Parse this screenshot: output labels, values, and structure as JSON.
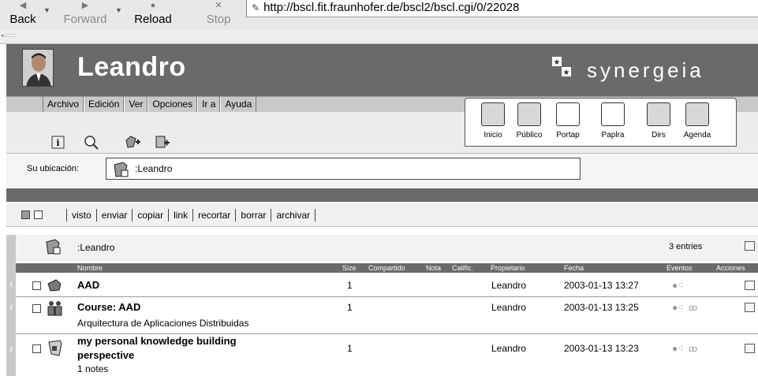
{
  "browser": {
    "back": "Back",
    "forward": "Forward",
    "reload": "Reload",
    "stop": "Stop",
    "url": "http://bscl.fit.fraunhofer.de/bscl2/bscl.cgi/0/22028"
  },
  "header": {
    "user_name": "Leandro",
    "brand": "synergeia"
  },
  "menu": [
    "Archivo",
    "Edición",
    "Ver",
    "Opciones",
    "Ir a",
    "Ayuda"
  ],
  "nav_tiles": [
    "Inicio",
    "Público",
    "Portap",
    "Paplra",
    "Dirs",
    "Agenda"
  ],
  "location": {
    "label": "Su ubicación:",
    "value": ":Leandro"
  },
  "actions": [
    "visto",
    "enviar",
    "copiar",
    "link",
    "recortar",
    "borrar",
    "archivar"
  ],
  "folder": {
    "name": ":Leandro",
    "entries": "3 entries"
  },
  "columns": {
    "nombre": "Nombre",
    "size": "Size",
    "compartido": "Compartido",
    "nota": "Nota",
    "calific": "Calific.",
    "propietario": "Propietario",
    "fecha": "Fecha",
    "eventos": "Eventos",
    "acciones": "Acciones"
  },
  "rows": [
    {
      "name": "AAD",
      "subtitle": "",
      "size": "1",
      "owner": "Leandro",
      "date": "2003-01-13 13:27"
    },
    {
      "name": "Course: AAD",
      "subtitle": "Arquitectura de Aplicaciones Distribuidas",
      "size": "1",
      "owner": "Leandro",
      "date": "2003-01-13 13:25"
    },
    {
      "name_line1": "my personal knowledge building",
      "name_line2": "perspective",
      "subtitle": "1 notes",
      "size": "1",
      "owner": "Leandro",
      "date": "2003-01-13 13:23"
    }
  ],
  "icons": {
    "info": "i",
    "eye": "glasses"
  }
}
